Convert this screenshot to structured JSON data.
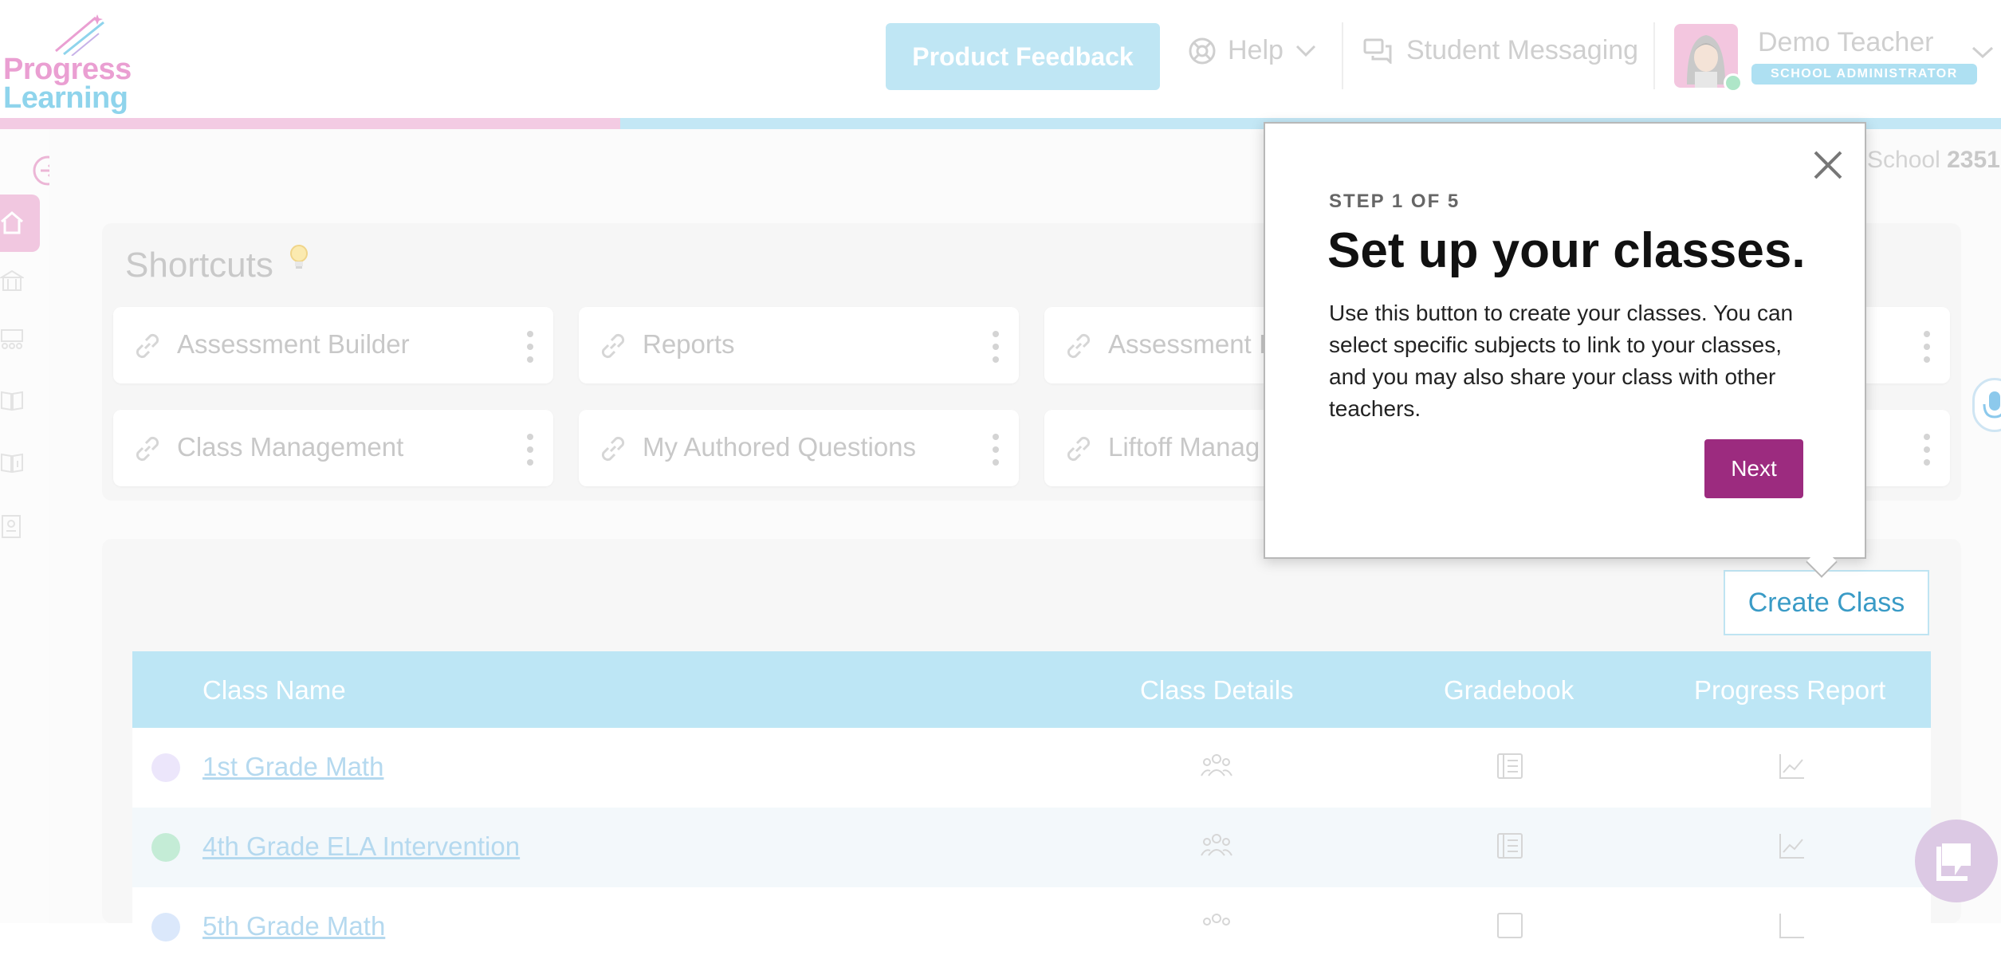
{
  "header": {
    "logo_line1": "Progress",
    "logo_line2": "Learning",
    "feedback_label": "Product Feedback",
    "help_label": "Help",
    "messaging_label": "Student Messaging",
    "user_name": "Demo Teacher",
    "user_role": "SCHOOL ADMINISTRATOR"
  },
  "progress": {
    "fraction": 0.31
  },
  "school": {
    "label": "School",
    "number": "2351"
  },
  "shortcuts": {
    "title": "Shortcuts",
    "items": [
      {
        "label": "Assessment Builder"
      },
      {
        "label": "Reports"
      },
      {
        "label": "Assessment I"
      },
      {
        "label": "Class Management"
      },
      {
        "label": "My Authored Questions"
      },
      {
        "label": "Liftoff Manag"
      }
    ]
  },
  "classes": {
    "create_label": "Create Class",
    "columns": [
      "Class Name",
      "Class Details",
      "Gradebook",
      "Progress Report"
    ],
    "rows": [
      {
        "name": "1st Grade Math",
        "dot_color": "#ece6fb"
      },
      {
        "name": "4th Grade ELA Intervention",
        "dot_color": "#c4ecd6"
      },
      {
        "name": "5th Grade Math",
        "dot_color": "#dbe8fb"
      }
    ]
  },
  "tour": {
    "step": "STEP 1 OF 5",
    "title": "Set up your classes.",
    "body": "Use this button to create your classes. You can select specific subjects to link to your classes, and you may also share your class with other teachers.",
    "next_label": "Next"
  },
  "colors": {
    "accent_purple": "#9c2b7f",
    "pink": "#ea9fd2",
    "blue": "#8fd4ec",
    "table_header": "#bde6f5"
  },
  "icons": [
    "shooting-star-icon",
    "help-circle-icon",
    "chevron-down-icon",
    "message-icon",
    "collapse-arrow-icon",
    "home-icon",
    "school-icon",
    "classroom-icon",
    "book-icon",
    "book-info-icon",
    "certificate-icon",
    "bulb-icon",
    "link-icon",
    "kebab-icon",
    "people-icon",
    "gradebook-icon",
    "chart-icon",
    "close-icon",
    "mic-icon",
    "chat-icon"
  ]
}
